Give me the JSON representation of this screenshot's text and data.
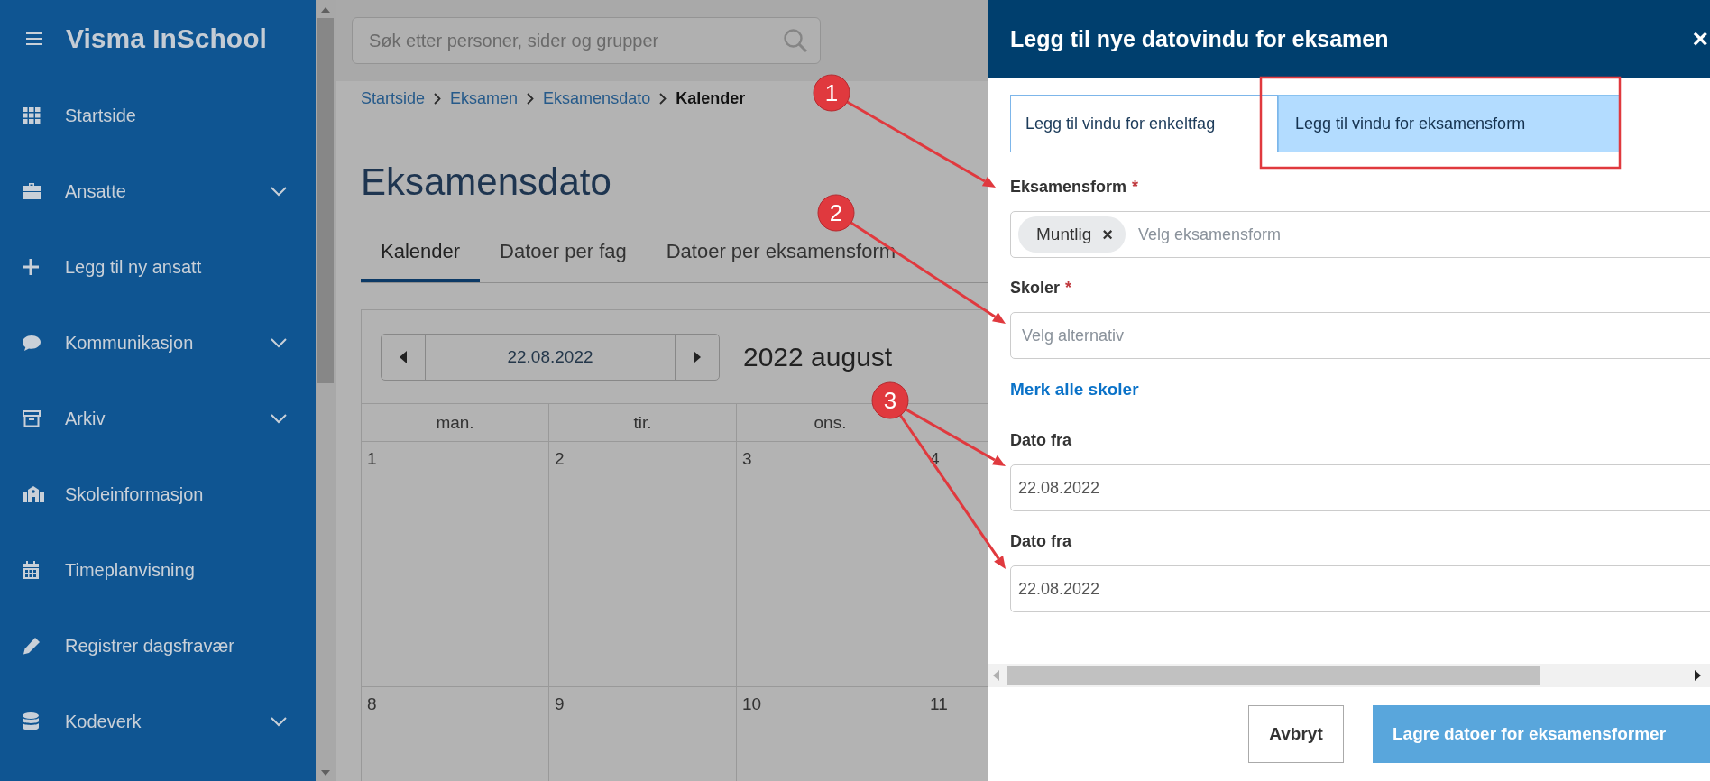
{
  "sidebar": {
    "brand": "Visma InSchool",
    "items": [
      {
        "label": "Startside",
        "expandable": false
      },
      {
        "label": "Ansatte",
        "expandable": true
      },
      {
        "label": "Legg til ny ansatt",
        "expandable": false
      },
      {
        "label": "Kommunikasjon",
        "expandable": true
      },
      {
        "label": "Arkiv",
        "expandable": true
      },
      {
        "label": "Skoleinformasjon",
        "expandable": false
      },
      {
        "label": "Timeplanvisning",
        "expandable": false
      },
      {
        "label": "Registrer dagsfravær",
        "expandable": false
      },
      {
        "label": "Kodeverk",
        "expandable": true
      }
    ]
  },
  "search": {
    "placeholder": "Søk etter personer, sider og grupper"
  },
  "breadcrumb": [
    {
      "label": "Startside",
      "current": false
    },
    {
      "label": "Eksamen",
      "current": false
    },
    {
      "label": "Eksamensdato",
      "current": false
    },
    {
      "label": "Kalender",
      "current": true
    }
  ],
  "page_title": "Eksamensdato",
  "tabs": [
    {
      "label": "Kalender",
      "selected": true
    },
    {
      "label": "Datoer per fag",
      "selected": false
    },
    {
      "label": "Datoer per eksamensform",
      "selected": false
    }
  ],
  "calendar": {
    "date": "22.08.2022",
    "month_title": "2022 august",
    "weekdays": [
      "man.",
      "tir.",
      "ons."
    ],
    "weeks": [
      [
        "1",
        "2",
        "3",
        "4"
      ],
      [
        "8",
        "9",
        "10",
        "11"
      ]
    ]
  },
  "dialog": {
    "title": "Legg til nye datovindu for eksamen",
    "close": "×",
    "tabs": [
      {
        "label": "Legg til vindu for enkeltfag",
        "selected": false
      },
      {
        "label": "Legg til vindu for eksamensform",
        "selected": true
      }
    ],
    "fields": [
      {
        "kind": "multiselect",
        "label": "Eksamensform",
        "required_mark": "*",
        "chips": [
          {
            "text": "Muntlig",
            "remove": "×"
          }
        ],
        "placeholder": "Velg eksamensform"
      },
      {
        "kind": "select",
        "label": "Skoler",
        "required_mark": "*",
        "placeholder": "Velg alternativ"
      },
      {
        "kind": "link",
        "text": "Merk alle skoler"
      },
      {
        "kind": "date",
        "label": "Dato fra",
        "value": "22.08.2022"
      },
      {
        "kind": "date",
        "label": "Dato fra",
        "value": "22.08.2022"
      }
    ],
    "buttons": [
      {
        "label": "Avbryt",
        "kind": "secondary"
      },
      {
        "label": "Lagre datoer for eksamensformer",
        "kind": "primary"
      }
    ]
  },
  "annotations": [
    {
      "label": "1"
    },
    {
      "label": "2"
    },
    {
      "label": "3"
    }
  ]
}
